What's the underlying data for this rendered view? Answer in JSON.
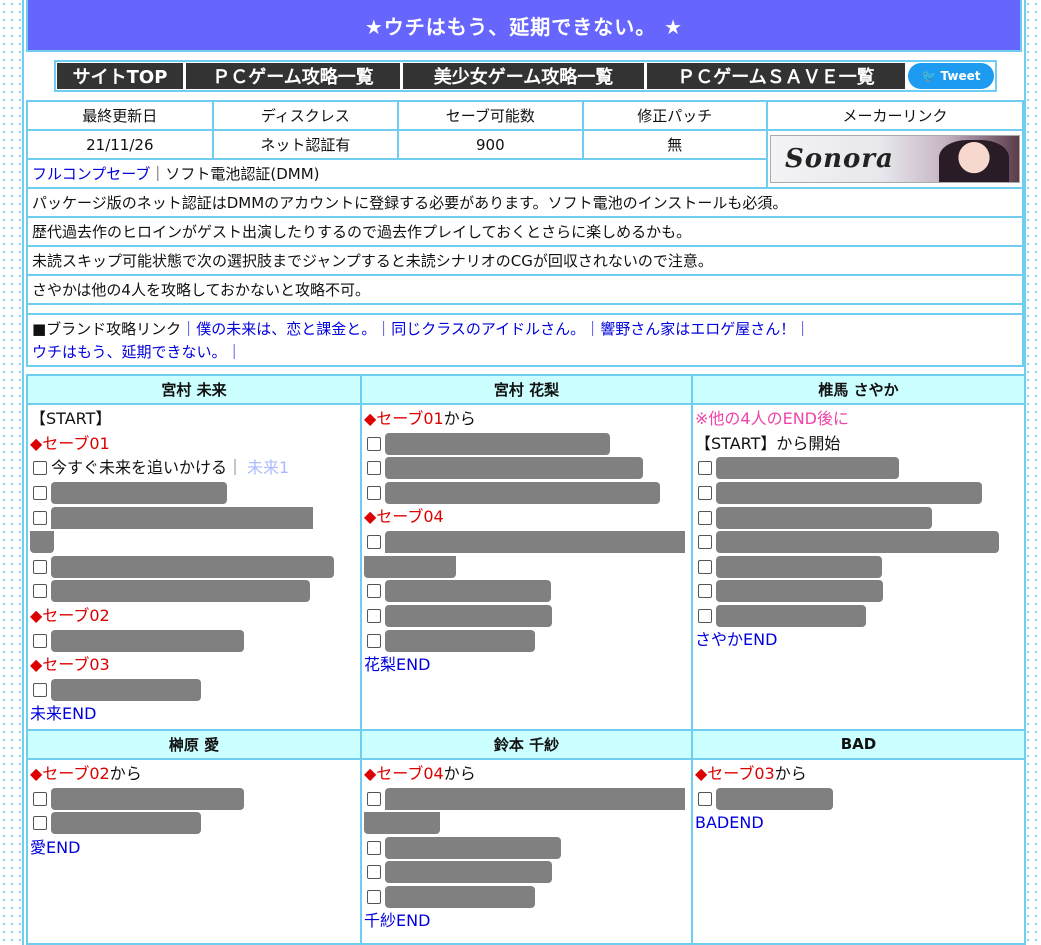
{
  "title": "★ウチはもう、延期できない。 ★",
  "nav": {
    "items": [
      "サイトTOP",
      "ＰＣゲーム攻略一覧",
      "美少女ゲーム攻略一覧",
      "ＰＣゲームＳＡＶＥ一覧"
    ],
    "tweet": "Tweet"
  },
  "info": {
    "headers": [
      "最終更新日",
      "ディスクレス",
      "セーブ可能数",
      "修正パッチ",
      "メーカーリンク"
    ],
    "values": [
      "21/11/26",
      "ネット認証有",
      "900",
      "無"
    ],
    "maker_logo": "SONORA",
    "save_line": {
      "link": "フルコンプセーブ",
      "text": "｜ソフト電池認証(DMM)"
    },
    "notes": [
      "パッケージ版のネット認証はDMMのアカウントに登録する必要があります。ソフト電池のインストールも必須。",
      "歴代過去作のヒロインがゲスト出演したりするので過去作プレイしておくとさらに楽しめるかも。",
      "未読スキップ可能状態で次の選択肢までジャンプすると未読シナリオのCGが回収されないので注意。",
      "さやかは他の4人を攻略しておかないと攻略不可。"
    ],
    "brand": {
      "label": "■ブランド攻略リンク",
      "links": [
        "僕の未来は、恋と課金と。",
        "同じクラスのアイドルさん。",
        "響野さん家はエロゲ屋さん！",
        "ウチはもう、延期できない。"
      ]
    }
  },
  "routes": {
    "miku": {
      "name": "宮村 未来",
      "start": "【START】",
      "save01": "◆セーブ01",
      "choice1": "今すぐ未来を追いかける",
      "choice1_tag": "未来1",
      "save02": "◆セーブ02",
      "save03": "◆セーブ03",
      "end": "未来END"
    },
    "karin": {
      "name": "宮村 花梨",
      "save01": "◆セーブ01",
      "from": "から",
      "save04": "◆セーブ04",
      "end": "花梨END"
    },
    "sayaka": {
      "name": "椎馬 さやか",
      "note": "※他の4人のEND後に",
      "start": "【START】から開始",
      "end": "さやかEND"
    },
    "ai": {
      "name": "榊原 愛",
      "save02": "◆セーブ02",
      "from": "から",
      "end": "愛END"
    },
    "chisa": {
      "name": "鈴本 千紗",
      "save04": "◆セーブ04",
      "from": "から",
      "end": "千紗END"
    },
    "bad": {
      "name": "BAD",
      "save03": "◆セーブ03",
      "from": "から",
      "end": "BADEND"
    }
  },
  "colors": {
    "title_bg": "#6666ff",
    "border": "#6fcdf0",
    "header_bg": "#ccffff",
    "save_red": "#dd0000",
    "link_blue": "#0000dd",
    "hidden_gray": "#808080"
  }
}
